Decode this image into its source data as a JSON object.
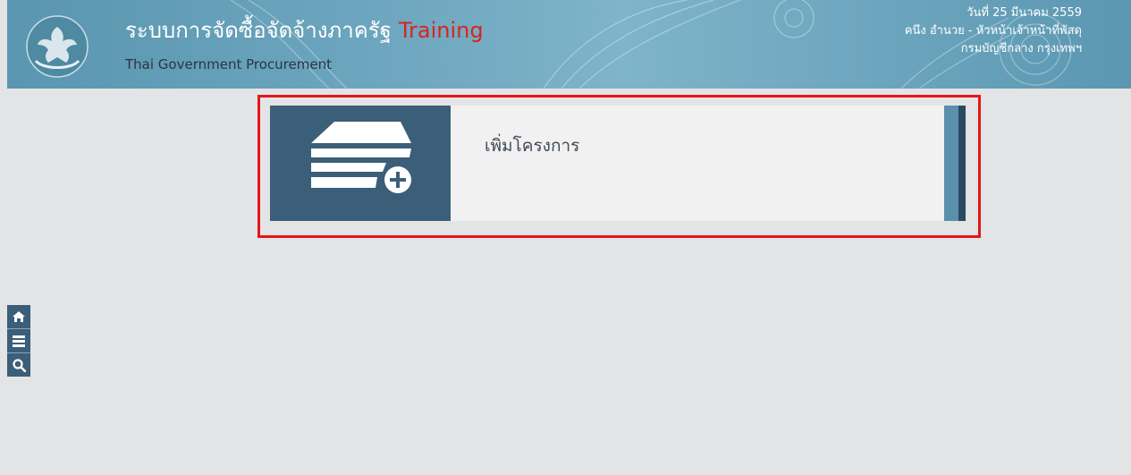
{
  "header": {
    "title": "ระบบการจัดซื้อจัดจ้างภาครัฐ",
    "title_suffix": "Training",
    "subtitle": "Thai Government Procurement",
    "date": "วันที่ 25 มีนาคม 2559",
    "user": "คนึง อำนวย - หัวหน้าเจ้าหน้าที่พัสดุ",
    "department": "กรมบัญชีกลาง กรุงเทพฯ",
    "logo_icon": "garuda-emblem-icon",
    "colors": {
      "header_bg": "#6ea7bf",
      "training_text": "#d9241d"
    }
  },
  "main": {
    "tile": {
      "label": "เพิ่มโครงการ",
      "icon": "add-project-stack-icon",
      "highlight_color": "#e4161a"
    }
  },
  "sidebar": {
    "buttons": [
      {
        "icon": "home-icon"
      },
      {
        "icon": "menu-icon"
      },
      {
        "icon": "search-icon"
      }
    ]
  }
}
